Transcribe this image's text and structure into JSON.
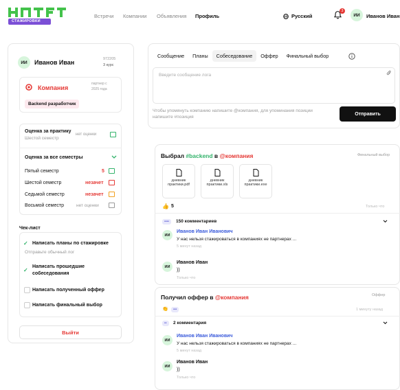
{
  "header": {
    "logo_text": "СТАЖИРОВКИ",
    "nav": [
      "Встречи",
      "Компании",
      "Объявления",
      "Профиль"
    ],
    "language": "Русский",
    "notifications": "3",
    "user_initials": "ИИ",
    "user_name": "Иванов Иван"
  },
  "profile": {
    "initials": "ИИ",
    "name": "Иванов Иван",
    "id": "972205",
    "course": "3 курс",
    "company_name": "Компания",
    "partner_label": "партнер с",
    "partner_year": "2025 года",
    "role_tag": "Backend разработчик",
    "practice": {
      "title": "Оценка за практику",
      "semester": "Шестой семестр",
      "value": "нет оценки"
    },
    "all_semesters_label": "Оценка за все семестры",
    "semesters": [
      {
        "name": "Пятый семестр",
        "value": "5"
      },
      {
        "name": "Шестой семестр",
        "value": "незачет"
      },
      {
        "name": "Седьмой семестр",
        "value": "незачет"
      },
      {
        "name": "Восьмой семестр",
        "value": "нет оценки"
      }
    ],
    "checklist_title": "Чек-лист",
    "checklist": [
      {
        "label": "Написать планы по стажировке",
        "sub": "Отправьте обычный лог",
        "done": true
      },
      {
        "label": "Написать прошедшие собеседования",
        "sub": "",
        "done": true
      },
      {
        "label": "Написать полученный оффер",
        "sub": "",
        "done": false
      },
      {
        "label": "Написать финальный выбор",
        "sub": "",
        "done": false
      }
    ],
    "logout": "Выйти"
  },
  "composer": {
    "tabs": [
      "Сообщение",
      "Планы",
      "Собеседование",
      "Оффер",
      "Финальный выбор"
    ],
    "active_tab": "Собеседование",
    "placeholder": "Введите сообщение лога",
    "hint": "Чтобы упомянуть компанию напишите @компания, для упоминания позиции напишите #позиция",
    "send": "Отправить"
  },
  "posts": [
    {
      "title_prefix": "Выбрал ",
      "hashtag": "#backend",
      "mid": " в ",
      "mention": "@компания",
      "type": "Финальный выбор",
      "files": [
        "дневник практики.pdf",
        "дневник практики.xls",
        "дневник практики.exe"
      ],
      "reactions": "5",
      "time": "Только что",
      "comments_count": "150 комментариев",
      "comments": [
        {
          "initials": "ИИ",
          "author": "Иванов Иван Иванович",
          "text": "У нас нельзя стажироваться в компаниях не партнерах ...",
          "time": "5 минут назад"
        },
        {
          "initials": "ИИ",
          "author": "Иванов Иван",
          "text": "))",
          "time": "Только что"
        }
      ]
    },
    {
      "title_prefix": "Получил оффер в ",
      "mention": "@компания",
      "type": "Оффер",
      "time": "1 минуту назад",
      "comments_count": "2 комментария",
      "comments": [
        {
          "initials": "ИИ",
          "author": "Иванов Иван Иванович",
          "text": "У нас нельзя стажироваться в компаниях не партнерах ...",
          "time": "5 минут назад"
        },
        {
          "initials": "ИИ",
          "author": "Иванов Иван",
          "text": "))",
          "time": "Только что"
        }
      ]
    }
  ]
}
